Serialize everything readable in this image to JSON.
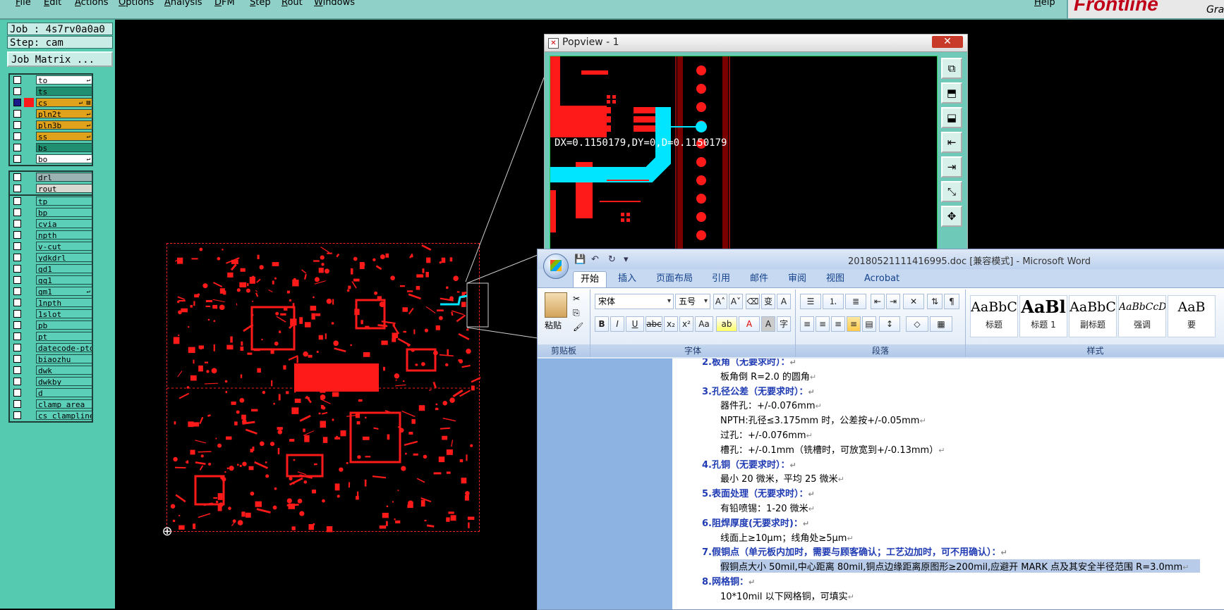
{
  "menubar": {
    "items": [
      "File",
      "Edit",
      "Actions",
      "Options",
      "Analysis",
      "DFM",
      "Step",
      "Rout",
      "Windows"
    ],
    "help": "Help",
    "logo": "Frontline",
    "logo_sub": "Gra"
  },
  "job": {
    "job_line": "Job : 4s7rv0a0a0",
    "step_line": "Step: cam",
    "matrix_button": "Job Matrix ..."
  },
  "layers": {
    "board_layers": [
      {
        "name": "to",
        "color": "#ffffff",
        "arrow": "↵"
      },
      {
        "name": "ts",
        "color": "#1f8f70",
        "arrow": ""
      },
      {
        "name": "cs",
        "color": "#e0a21a",
        "arrow": "↵ ▤",
        "selected": true
      },
      {
        "name": "pln2t",
        "color": "#e0a21a",
        "arrow": "↵"
      },
      {
        "name": "pln3b",
        "color": "#e0a21a",
        "arrow": "↵"
      },
      {
        "name": "ss",
        "color": "#e0a21a",
        "arrow": "↵"
      },
      {
        "name": "bs",
        "color": "#1f8f70",
        "arrow": ""
      },
      {
        "name": "bo",
        "color": "#ffffff",
        "arrow": "↵"
      }
    ],
    "drill_layers": [
      {
        "name": "drl",
        "color": "#9bb3b3"
      },
      {
        "name": "rout",
        "color": "#d8d8d0"
      }
    ],
    "misc_layers": [
      {
        "name": "tp",
        "arrow": ""
      },
      {
        "name": "bp",
        "arrow": ""
      },
      {
        "name": "cvia",
        "arrow": ""
      },
      {
        "name": "npth",
        "arrow": ""
      },
      {
        "name": "v-cut",
        "arrow": ""
      },
      {
        "name": "ydkdrl",
        "arrow": ""
      },
      {
        "name": "gd1",
        "arrow": ""
      },
      {
        "name": "gg1",
        "arrow": ""
      },
      {
        "name": "gm1",
        "arrow": "↵"
      },
      {
        "name": "1npth",
        "arrow": ""
      },
      {
        "name": "1slot",
        "arrow": ""
      },
      {
        "name": "pb",
        "arrow": ""
      },
      {
        "name": "pt",
        "arrow": ""
      },
      {
        "name": "datecode-pto",
        "arrow": ""
      },
      {
        "name": "biaozhu",
        "arrow": ""
      },
      {
        "name": "dwk",
        "arrow": ""
      },
      {
        "name": "dwkby",
        "arrow": ""
      },
      {
        "name": "d",
        "arrow": ""
      },
      {
        "name": "clamp_area",
        "arrow": ""
      },
      {
        "name": "cs_clampline",
        "arrow": ""
      }
    ],
    "misc_color": "#5ccfb8"
  },
  "popview": {
    "title": "Popview - 1",
    "close": "✕",
    "measure": "DX=0.1150179,DY=0,D=0.1150179",
    "tools": [
      "⧉",
      "⬒",
      "⬓",
      "⇤",
      "⇥",
      "⤡",
      "✥"
    ]
  },
  "word": {
    "title": "20180521111416995.doc [兼容模式] - Microsoft Word",
    "tabs": [
      "开始",
      "插入",
      "页面布局",
      "引用",
      "邮件",
      "审阅",
      "视图",
      "Acrobat"
    ],
    "clipboard": {
      "paste": "粘贴",
      "label": "剪贴板"
    },
    "font": {
      "name": "宋体",
      "size": "五号",
      "label": "字体"
    },
    "paragraph": {
      "label": "段落"
    },
    "styles": {
      "label": "样式",
      "items": [
        {
          "sample": "AaBbC",
          "name": "标题"
        },
        {
          "sample": "AaBl",
          "name": "标题 1"
        },
        {
          "sample": "AaBbC",
          "name": "副标题"
        },
        {
          "sample": "AaBbCcDd",
          "name": "强调"
        },
        {
          "sample": "AaB",
          "name": "要"
        }
      ]
    },
    "doc_lines": [
      {
        "text": "2.板角（无要求时）：",
        "heading": true
      },
      {
        "text": "板角倒 R=2.0 的圆角"
      },
      {
        "text": "3.孔径公差（无要求时）：",
        "heading": true
      },
      {
        "text": "器件孔：+/-0.076mm"
      },
      {
        "text": "NPTH:孔径≤3.175mm 时，公差按+/-0.05mm"
      },
      {
        "text": "过孔：+/-0.076mm"
      },
      {
        "text": "槽孔：+/-0.1mm（铣槽时，可放宽到+/-0.13mm）"
      },
      {
        "text": "4.孔铜（无要求时）：",
        "heading": true
      },
      {
        "text": "最小 20 微米，平均 25 微米"
      },
      {
        "text": "5.表面处理（无要求时）：",
        "heading": true
      },
      {
        "text": "有铅喷锡：1-20 微米"
      },
      {
        "text": "6.阻焊厚度(无要求时)：",
        "heading": true
      },
      {
        "text": "线面上≥10μm；线角处≥5μm"
      },
      {
        "text": "7.假铜点（单元板内加时，需要与顾客确认；工艺边加时，可不用确认）：",
        "heading": true
      },
      {
        "text": "假铜点大小 50mil,中心距离 80mil,铜点边缘距离原图形≥200mil,应避开 MARK 点及其安全半径范围 R=3.0mm",
        "highlight": true
      },
      {
        "text": "8.网格铜：",
        "heading": true
      },
      {
        "text": "10*10mil 以下网格铜，可填实"
      }
    ],
    "para_mark": "↵"
  },
  "colors": {
    "copper": "#ff1a1a",
    "selection": "#00e5ff",
    "panel": "#56c9b1"
  }
}
